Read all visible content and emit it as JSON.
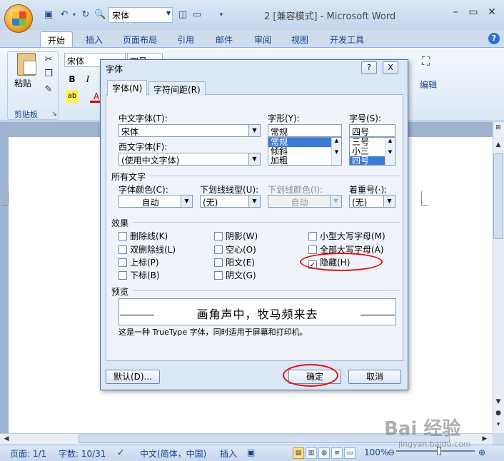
{
  "titlebar": {
    "font_combo": "宋体",
    "window_title": "2 [兼容模式] - Microsoft Word"
  },
  "tabs": [
    "开始",
    "插入",
    "页面布局",
    "引用",
    "邮件",
    "审阅",
    "视图",
    "开发工具"
  ],
  "ribbon": {
    "paste_label": "粘贴",
    "clipboard_label": "剪贴板",
    "font_name": "宋体",
    "font_size": "四号",
    "bold": "B",
    "italic": "I",
    "edit_label": "编辑"
  },
  "dialog": {
    "title": "字体",
    "help_btn": "?",
    "close_btn": "X",
    "tabs": [
      "字体(N)",
      "字符间距(R)"
    ],
    "labels": {
      "cn_font": "中文字体(T):",
      "west_font": "西文字体(F):",
      "style": "字形(Y):",
      "size": "字号(S):",
      "all_text": "所有文字",
      "font_color": "字体颜色(C):",
      "underline": "下划线线型(U):",
      "underline_color": "下划线颜色(I):",
      "emphasis": "着重号(·):",
      "effects": "效果",
      "preview": "预览"
    },
    "values": {
      "cn_font": "宋体",
      "west_font": "(使用中文字体)",
      "style": "常规",
      "size": "四号",
      "font_color": "自动",
      "underline": "(无)",
      "underline_color": "自动",
      "emphasis": "(无)"
    },
    "style_list": [
      "常规",
      "倾斜",
      "加粗"
    ],
    "size_list": [
      "三号",
      "小三",
      "四号"
    ],
    "effects": {
      "strikethrough": "删除线(K)",
      "double_strike": "双删除线(L)",
      "superscript": "上标(P)",
      "subscript": "下标(B)",
      "shadow": "阴影(W)",
      "outline": "空心(O)",
      "emboss": "阳文(E)",
      "engrave": "阴文(G)",
      "small_caps": "小型大写字母(M)",
      "all_caps": "全部大写字母(A)",
      "hidden": "隐藏(H)",
      "hidden_check": "✓"
    },
    "preview_text": "画角声中，牧马频来去",
    "preview_note": "这是一种 TrueType 字体，同时适用于屏幕和打印机。",
    "buttons": {
      "default": "默认(D)...",
      "ok": "确定",
      "cancel": "取消"
    }
  },
  "statusbar": {
    "page": "页面: 1/1",
    "words": "字数: 10/31",
    "language": "中文(简体，中国)",
    "mode": "插入",
    "zoom": "100%"
  },
  "watermark": "Bai 经验",
  "watermark_sub": "jingyan.baidu.com"
}
